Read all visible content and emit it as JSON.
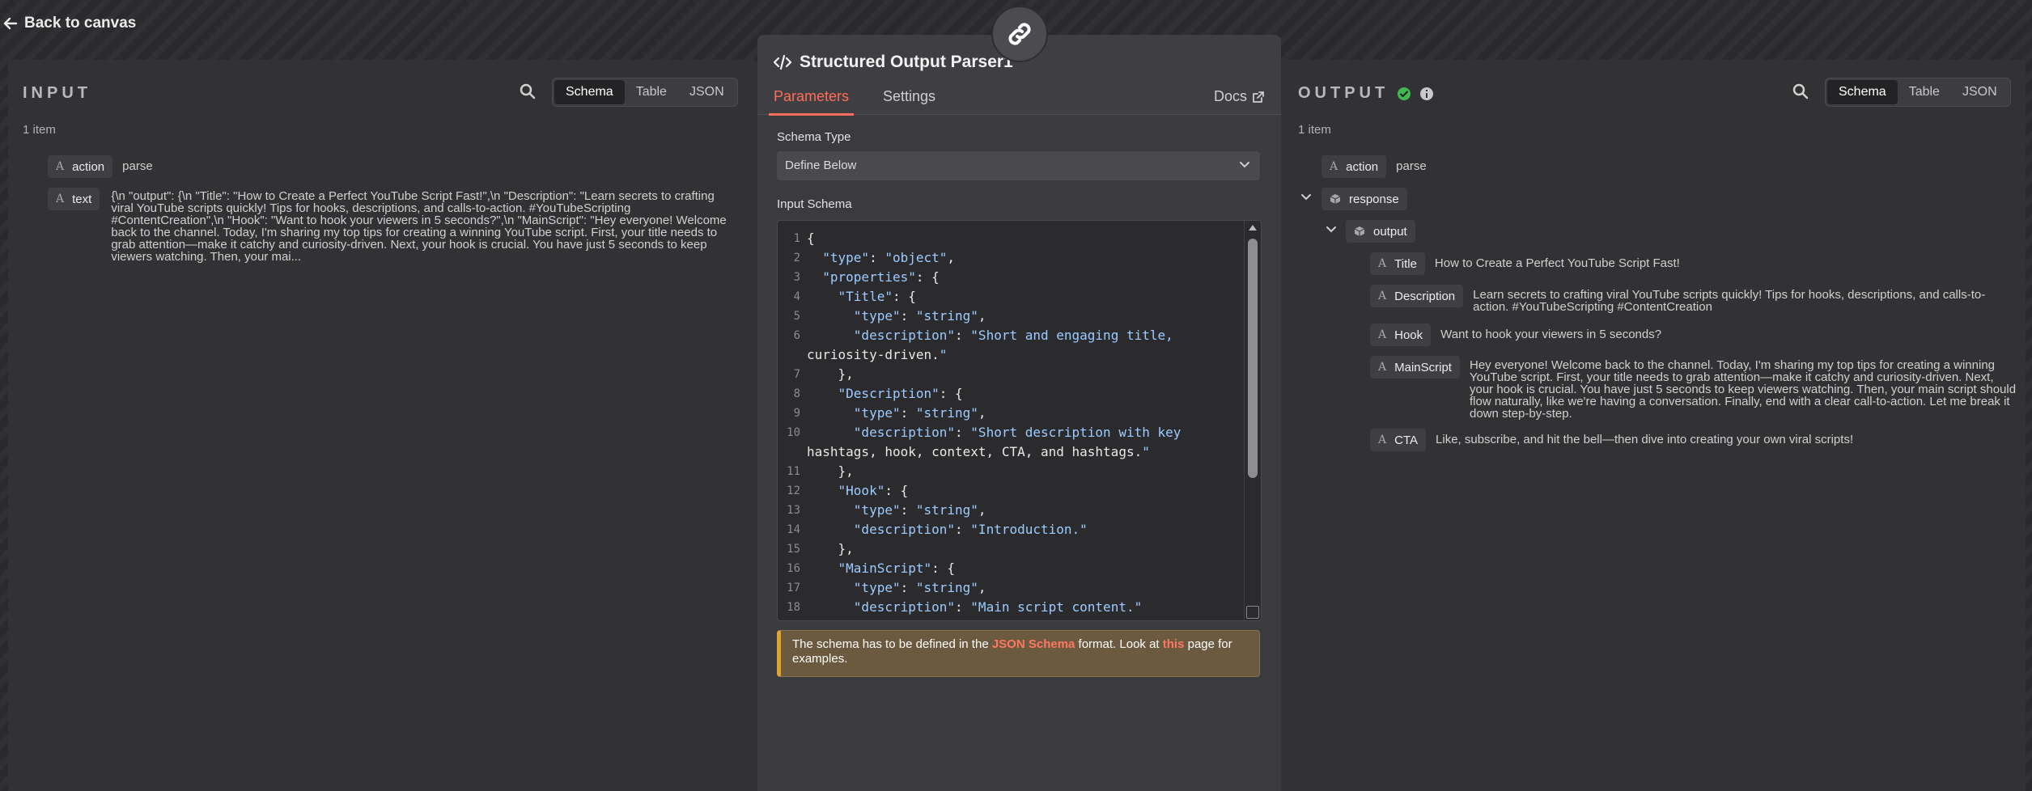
{
  "topbar": {
    "back_label": "Back to canvas"
  },
  "input": {
    "title": "INPUT",
    "count": "1 item",
    "tabs": [
      "Schema",
      "Table",
      "JSON"
    ],
    "fields": [
      {
        "name": "action",
        "value": "parse"
      },
      {
        "name": "text",
        "value": "{\\n \"output\": {\\n \"Title\": \"How to Create a Perfect YouTube Script Fast!\",\\n \"Description\": \"Learn secrets to crafting viral YouTube scripts quickly! Tips for hooks, descriptions, and calls-to-action. #YouTubeScripting #ContentCreation\",\\n \"Hook\": \"Want to hook your viewers in 5 seconds?\",\\n \"MainScript\": \"Hey everyone! Welcome back to the channel. Today, I'm sharing my top tips for creating a winning YouTube script. First, your title needs to grab attention—make it catchy and curiosity-driven. Next, your hook is crucial. You have just 5 seconds to keep viewers watching. Then, your mai..."
      }
    ]
  },
  "node": {
    "title": "Structured Output Parser1",
    "tabs": {
      "parameters": "Parameters",
      "settings": "Settings",
      "docs": "Docs"
    },
    "schema_type_label": "Schema Type",
    "schema_type_value": "Define Below",
    "input_schema_label": "Input Schema",
    "code_lines": [
      [
        "1",
        "{"
      ],
      [
        "2",
        "  \"type\": \"object\","
      ],
      [
        "3",
        "  \"properties\": {"
      ],
      [
        "4",
        "    \"Title\": {"
      ],
      [
        "5",
        "      \"type\": \"string\","
      ],
      [
        "6",
        "      \"description\": \"Short and engaging title,"
      ],
      [
        "",
        "curiosity-driven.\""
      ],
      [
        "7",
        "    },"
      ],
      [
        "8",
        "    \"Description\": {"
      ],
      [
        "9",
        "      \"type\": \"string\","
      ],
      [
        "10",
        "      \"description\": \"Short description with key"
      ],
      [
        "",
        "hashtags, hook, context, CTA, and hashtags.\""
      ],
      [
        "11",
        "    },"
      ],
      [
        "12",
        "    \"Hook\": {"
      ],
      [
        "13",
        "      \"type\": \"string\","
      ],
      [
        "14",
        "      \"description\": \"Introduction.\""
      ],
      [
        "15",
        "    },"
      ],
      [
        "16",
        "    \"MainScript\": {"
      ],
      [
        "17",
        "      \"type\": \"string\","
      ],
      [
        "18",
        "      \"description\": \"Main script content.\""
      ]
    ],
    "notice": {
      "pre": "The schema has to be defined in the ",
      "link1": "JSON Schema",
      "mid": " format. Look at ",
      "link2": "this",
      "post": " page for examples."
    }
  },
  "output": {
    "title": "OUTPUT",
    "count": "1 item",
    "tabs": [
      "Schema",
      "Table",
      "JSON"
    ],
    "action": {
      "name": "action",
      "value": "parse"
    },
    "response_label": "response",
    "output_label": "output",
    "fields": [
      {
        "name": "Title",
        "value": "How to Create a Perfect YouTube Script Fast!"
      },
      {
        "name": "Description",
        "value": "Learn secrets to crafting viral YouTube scripts quickly! Tips for hooks, descriptions, and calls-to-action. #YouTubeScripting #ContentCreation"
      },
      {
        "name": "Hook",
        "value": "Want to hook your viewers in 5 seconds?"
      },
      {
        "name": "MainScript",
        "value": "Hey everyone! Welcome back to the channel. Today, I'm sharing my top tips for creating a winning YouTube script. First, your title needs to grab attention—make it catchy and curiosity-driven. Next, your hook is crucial. You have just 5 seconds to keep viewers watching. Then, your main script should flow naturally, like we're having a conversation. Finally, end with a clear call-to-action. Let me break it down step-by-step."
      },
      {
        "name": "CTA",
        "value": "Like, subscribe, and hit the bell—then dive into creating your own viral scripts!"
      }
    ]
  },
  "colors": {
    "accent": "#ff6e5a",
    "success": "#3fb950",
    "warning_border": "#e0a32b"
  }
}
